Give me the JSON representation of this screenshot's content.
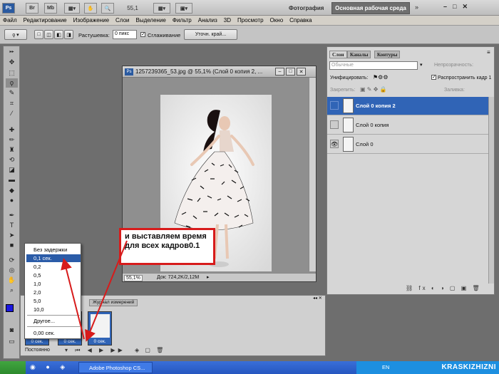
{
  "appbar": {
    "logo": "Ps",
    "br": "Br",
    "mb": "Mb",
    "zoom": "55,1",
    "workspace_photo": "Фотография",
    "workspace_main": "Основная рабочая среда"
  },
  "menu": [
    "Файл",
    "Редактирование",
    "Изображение",
    "Слои",
    "Выделение",
    "Фильтр",
    "Анализ",
    "3D",
    "Просмотр",
    "Окно",
    "Справка"
  ],
  "options": {
    "feather_label": "Растушевка:",
    "feather_value": "0 пикс",
    "antialias_label": "Сглаживание",
    "refine_button": "Уточн. край..."
  },
  "document": {
    "title": "1257239365_53.jpg @ 55,1% (Слой 0 копия 2, ...",
    "zoom": "55,1%",
    "doc_info": "Док: 724,2K/2,12M"
  },
  "layers_panel": {
    "tabs": [
      "Слои",
      "Каналы",
      "Контуры"
    ],
    "blend_mode": "Обычные",
    "opacity_label": "Непрозрачность:",
    "unify_label": "Унифицировать:",
    "propagate_label": "Распространить кадр 1",
    "lock_label": "Закрепить:",
    "fill_label": "Заливка:",
    "layers": [
      {
        "name": "Слой 0 копия 2",
        "selected": true
      },
      {
        "name": "Слой 0 копия",
        "selected": false
      },
      {
        "name": "Слой 0",
        "selected": false
      }
    ]
  },
  "animation_panel": {
    "tab_label": "Журнал измерений",
    "frame_delay": "0 сек.",
    "loop_label": "Постоянно"
  },
  "delay_menu": {
    "items": [
      "Без задержки",
      "0,1 сек.",
      "0,2",
      "0,5",
      "1,0",
      "2,0",
      "5,0",
      "10,0"
    ],
    "other": "Другое...",
    "current": "0,00 сек.",
    "selected_index": 1
  },
  "callout": {
    "text": "и выставляем время для всех кадров0.1"
  },
  "taskbar": {
    "task_label": "Adobe Photoshop CS...",
    "lang": "EN",
    "brand": "KRASKIZHIZNI"
  }
}
